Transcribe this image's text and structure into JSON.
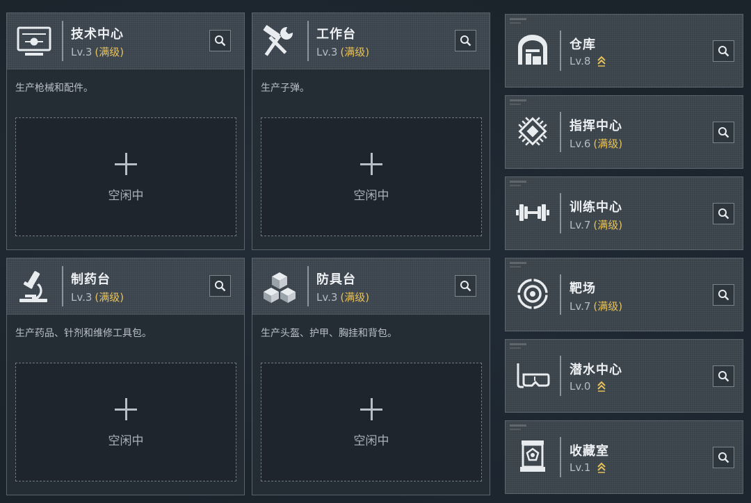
{
  "benches": [
    {
      "title": "技术中心",
      "level": "Lv.3",
      "level_tag": "(满级)",
      "desc": "生产枪械和配件。",
      "slot_text": "空闲中",
      "icon": "computer-terminal-icon"
    },
    {
      "title": "工作台",
      "level": "Lv.3",
      "level_tag": "(满级)",
      "desc": "生产子弹。",
      "slot_text": "空闲中",
      "icon": "hammer-wrench-icon"
    },
    {
      "title": "制药台",
      "level": "Lv.3",
      "level_tag": "(满级)",
      "desc": "生产药品、针剂和维修工具包。",
      "slot_text": "空闲中",
      "icon": "microscope-icon"
    },
    {
      "title": "防具台",
      "level": "Lv.3",
      "level_tag": "(满级)",
      "desc": "生产头盔、护甲、胸挂和背包。",
      "slot_text": "空闲中",
      "icon": "boxes-icon"
    }
  ],
  "facilities": [
    {
      "title": "仓库",
      "level": "Lv.8",
      "level_tag": "",
      "upgradable": true,
      "icon": "warehouse-icon"
    },
    {
      "title": "指挥中心",
      "level": "Lv.6",
      "level_tag": "(满级)",
      "upgradable": false,
      "icon": "chip-icon"
    },
    {
      "title": "训练中心",
      "level": "Lv.7",
      "level_tag": "(满级)",
      "upgradable": false,
      "icon": "dumbbell-icon"
    },
    {
      "title": "靶场",
      "level": "Lv.7",
      "level_tag": "(满级)",
      "upgradable": false,
      "icon": "target-icon"
    },
    {
      "title": "潜水中心",
      "level": "Lv.0",
      "level_tag": "",
      "upgradable": true,
      "icon": "diving-mask-icon"
    },
    {
      "title": "收藏室",
      "level": "Lv.1",
      "level_tag": "",
      "upgradable": true,
      "icon": "display-case-icon"
    }
  ],
  "colors": {
    "max_level": "#e8c25a",
    "upgrade_arrow": "#e8c25a"
  }
}
